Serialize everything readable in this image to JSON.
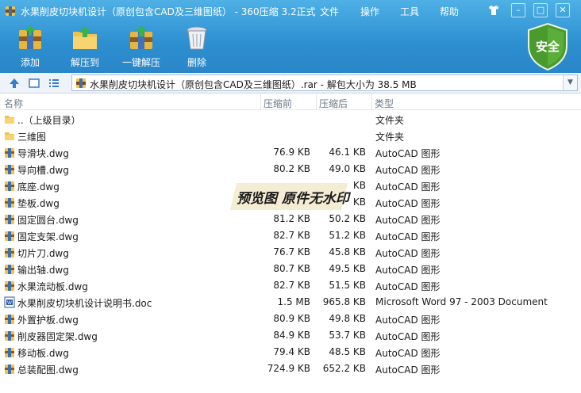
{
  "window": {
    "title": "水果削皮切块机设计（原创包含CAD及三维图纸） - 360压缩 3.2正式",
    "menu": [
      "文件",
      "操作",
      "工具",
      "帮助"
    ],
    "controls": [
      "shirt-icon",
      "minimize",
      "maximize",
      "close"
    ]
  },
  "toolbar": [
    {
      "label": "添加",
      "icon": "add-icon"
    },
    {
      "label": "解压到",
      "icon": "extract-to-icon"
    },
    {
      "label": "一键解压",
      "icon": "one-click-extract-icon"
    },
    {
      "label": "删除",
      "icon": "delete-icon"
    }
  ],
  "security": {
    "label": "安全"
  },
  "address": {
    "text": "水果削皮切块机设计（原创包含CAD及三维图纸）.rar - 解包大小为 38.5 MB"
  },
  "columns": {
    "name": "名称",
    "before": "压缩前",
    "after": "压缩后",
    "type": "类型"
  },
  "files": [
    {
      "name": "..（上级目录）",
      "before": "",
      "after": "",
      "type": "文件夹",
      "icon": "folder"
    },
    {
      "name": "三维图",
      "before": "",
      "after": "",
      "type": "文件夹",
      "icon": "folder"
    },
    {
      "name": "导滑块.dwg",
      "before": "76.9 KB",
      "after": "46.1 KB",
      "type": "AutoCAD 图形",
      "icon": "dwg"
    },
    {
      "name": "导向槽.dwg",
      "before": "80.2 KB",
      "after": "49.0 KB",
      "type": "AutoCAD 图形",
      "icon": "dwg"
    },
    {
      "name": "底座.dwg",
      "before": "",
      "after": "KB",
      "type": "AutoCAD 图形",
      "icon": "dwg"
    },
    {
      "name": "垫板.dwg",
      "before": "",
      "after": "KB",
      "type": "AutoCAD 图形",
      "icon": "dwg"
    },
    {
      "name": "固定圆台.dwg",
      "before": "81.2 KB",
      "after": "50.2 KB",
      "type": "AutoCAD 图形",
      "icon": "dwg"
    },
    {
      "name": "固定支架.dwg",
      "before": "82.7 KB",
      "after": "51.2 KB",
      "type": "AutoCAD 图形",
      "icon": "dwg"
    },
    {
      "name": "切片刀.dwg",
      "before": "76.7 KB",
      "after": "45.8 KB",
      "type": "AutoCAD 图形",
      "icon": "dwg"
    },
    {
      "name": "输出轴.dwg",
      "before": "80.7 KB",
      "after": "49.5 KB",
      "type": "AutoCAD 图形",
      "icon": "dwg"
    },
    {
      "name": "水果流动板.dwg",
      "before": "82.7 KB",
      "after": "51.5 KB",
      "type": "AutoCAD 图形",
      "icon": "dwg"
    },
    {
      "name": "水果削皮切块机设计说明书.doc",
      "before": "1.5 MB",
      "after": "965.8 KB",
      "type": "Microsoft Word 97 - 2003 Document",
      "icon": "doc"
    },
    {
      "name": "外置护板.dwg",
      "before": "80.9 KB",
      "after": "49.8 KB",
      "type": "AutoCAD 图形",
      "icon": "dwg"
    },
    {
      "name": "削皮器固定架.dwg",
      "before": "84.9 KB",
      "after": "53.7 KB",
      "type": "AutoCAD 图形",
      "icon": "dwg"
    },
    {
      "name": "移动板.dwg",
      "before": "79.4 KB",
      "after": "48.5 KB",
      "type": "AutoCAD 图形",
      "icon": "dwg"
    },
    {
      "name": "总装配图.dwg",
      "before": "724.9 KB",
      "after": "652.2 KB",
      "type": "AutoCAD 图形",
      "icon": "dwg"
    }
  ],
  "watermark": {
    "text": "预览图 原件无水印"
  },
  "colors": {
    "titlebar": "#2d8fd0",
    "folder": "#f3c24a",
    "shield": "#4a9a2e"
  }
}
